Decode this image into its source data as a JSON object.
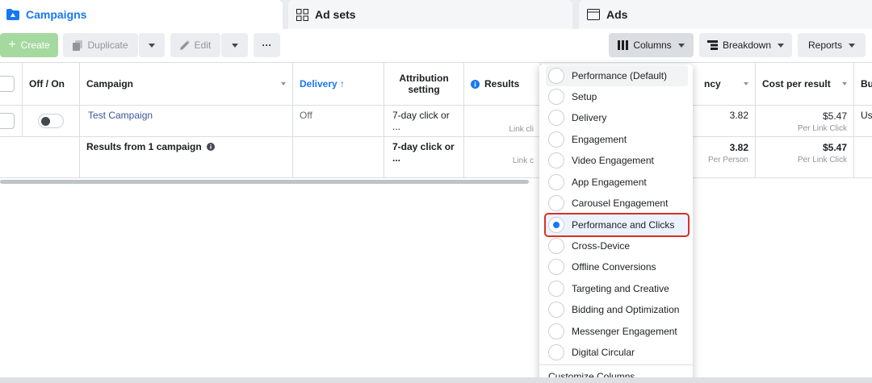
{
  "tabs": {
    "campaigns": "Campaigns",
    "ad_sets": "Ad sets",
    "ads": "Ads"
  },
  "toolbar": {
    "create": "Create",
    "duplicate": "Duplicate",
    "edit": "Edit",
    "more": "···",
    "columns": "Columns",
    "breakdown": "Breakdown",
    "reports": "Reports"
  },
  "table": {
    "headers": {
      "off_on": "Off / On",
      "campaign": "Campaign",
      "delivery": "Delivery ↑",
      "attribution": "Attribution setting",
      "results": "Results",
      "frequency": "ncy",
      "cost_per_result": "Cost per result",
      "bu": "Bu"
    },
    "row": {
      "campaign": "Test Campaign",
      "delivery": "Off",
      "attribution": "7-day click or ...",
      "results_sub": "Link cli",
      "frequency": "3.82",
      "cost": "$5.47",
      "cost_sub": "Per Link Click",
      "bu": "Us"
    },
    "summary": {
      "label": "Results from 1 campaign",
      "attribution": "7-day click or ...",
      "results_sub": "Link c",
      "frequency": "3.82",
      "frequency_sub": "Per Person",
      "cost": "$5.47",
      "cost_sub": "Per Link Click"
    }
  },
  "columns_menu": {
    "options": [
      "Performance (Default)",
      "Setup",
      "Delivery",
      "Engagement",
      "Video Engagement",
      "App Engagement",
      "Carousel Engagement",
      "Performance and Clicks",
      "Cross-Device",
      "Offline Conversions",
      "Targeting and Creative",
      "Bidding and Optimization",
      "Messenger Engagement",
      "Digital Circular"
    ],
    "selected": "Performance and Clicks",
    "footer": "Customize Columns..."
  },
  "colors": {
    "accent": "#1877f2",
    "link": "#385898",
    "highlight_outline": "#d93025"
  }
}
